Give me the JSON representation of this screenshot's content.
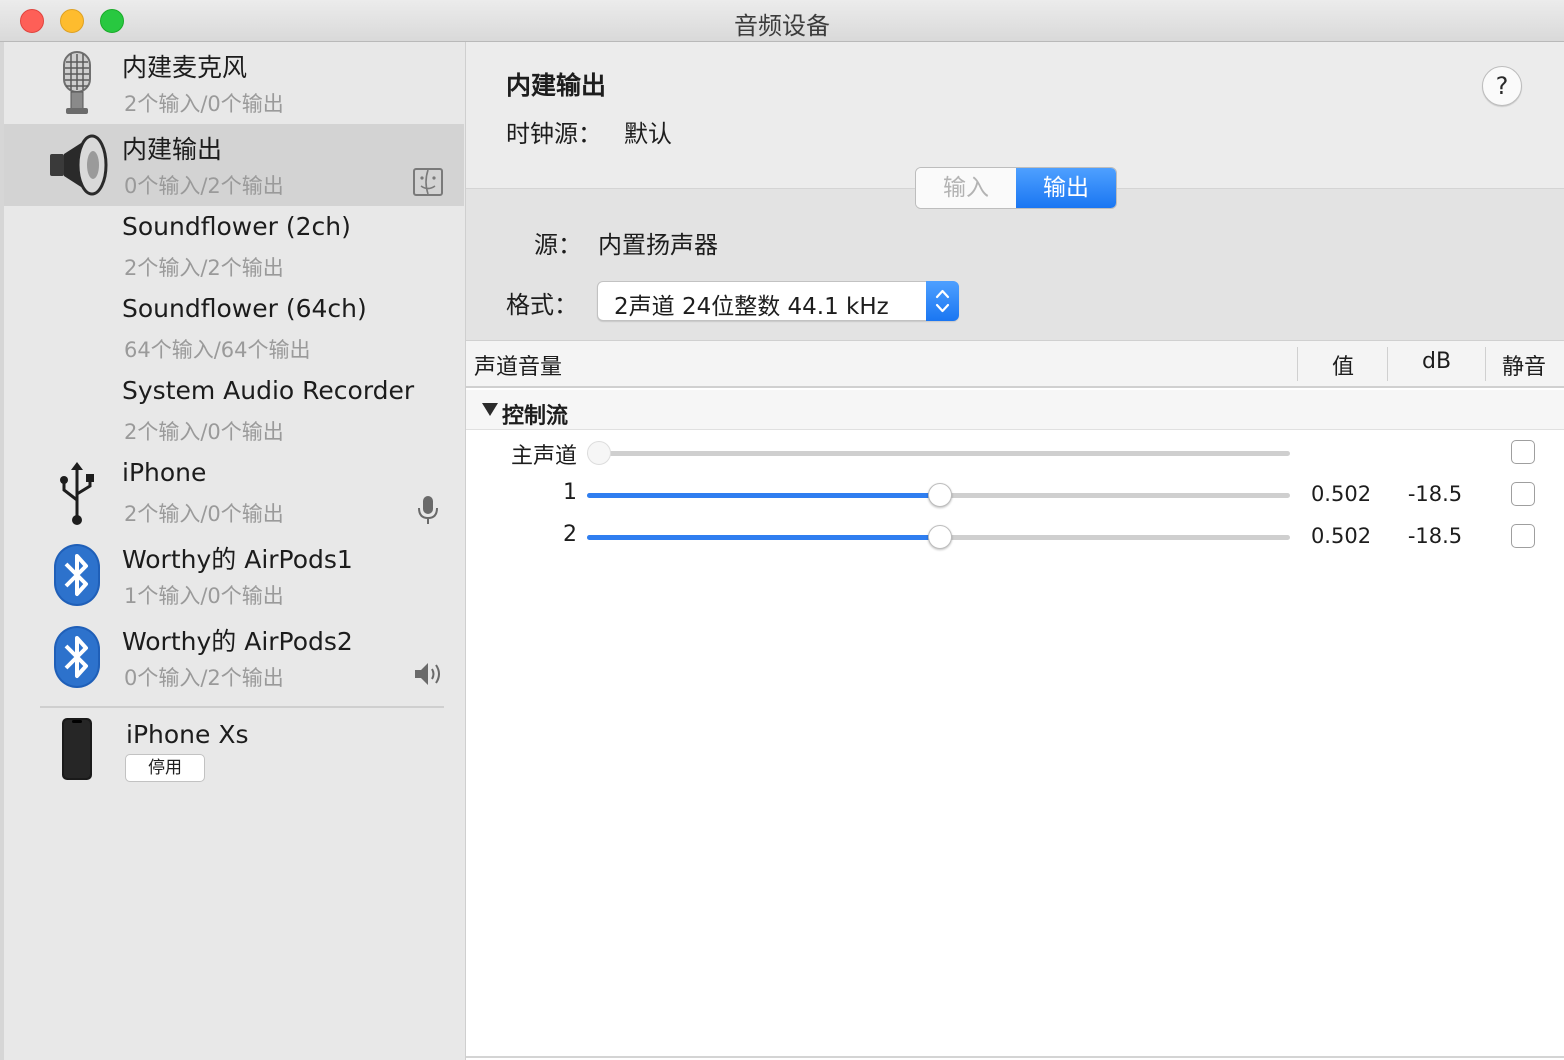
{
  "window": {
    "title": "音频设备"
  },
  "devices": [
    {
      "name": "内建麦克风",
      "io": "2个输入/0个输出",
      "icon": "microphone-icon"
    },
    {
      "name": "内建输出",
      "io": "0个输入/2个输出",
      "icon": "speaker-icon",
      "badge": "finder-icon",
      "selected": true
    },
    {
      "name": "Soundflower (2ch)",
      "io": "2个输入/2个输出"
    },
    {
      "name": "Soundflower (64ch)",
      "io": "64个输入/64个输出"
    },
    {
      "name": "System Audio Recorder",
      "io": "2个输入/0个输出"
    },
    {
      "name": "iPhone",
      "io": "2个输入/0个输出",
      "icon": "usb-icon",
      "badge": "microphone-badge-icon"
    },
    {
      "name": "Worthy的 AirPods1",
      "io": "1个输入/0个输出",
      "icon": "bluetooth-icon"
    },
    {
      "name": "Worthy的 AirPods2",
      "io": "0个输入/2个输出",
      "icon": "bluetooth-icon",
      "badge": "volume-icon"
    }
  ],
  "external_device": {
    "name": "iPhone Xs",
    "button": "停用",
    "icon": "iphone-icon"
  },
  "detail": {
    "title": "内建输出",
    "clock_label": "时钟源：",
    "clock_value": "默认",
    "help": "?",
    "tabs": {
      "input": "输入",
      "output": "输出",
      "active": "output"
    },
    "source_label": "源：",
    "source_value": "内置扬声器",
    "format_label": "格式：",
    "format_value": "2声道 24位整数 44.1 kHz"
  },
  "table": {
    "headers": {
      "channel": "声道音量",
      "value": "值",
      "db": "dB",
      "mute": "静音"
    },
    "group": "控制流",
    "rows": [
      {
        "label": "主声道",
        "level": 0.0,
        "value": "",
        "db": "",
        "enabled": false,
        "muted": false
      },
      {
        "label": "1",
        "level": 0.502,
        "value": "0.502",
        "db": "-18.5",
        "enabled": true,
        "muted": false
      },
      {
        "label": "2",
        "level": 0.502,
        "value": "0.502",
        "db": "-18.5",
        "enabled": true,
        "muted": false
      }
    ]
  },
  "colors": {
    "accent": "#2f7ef0",
    "selected_row": "#d3d3d3",
    "sidebar_bg": "#e8e8e8"
  }
}
